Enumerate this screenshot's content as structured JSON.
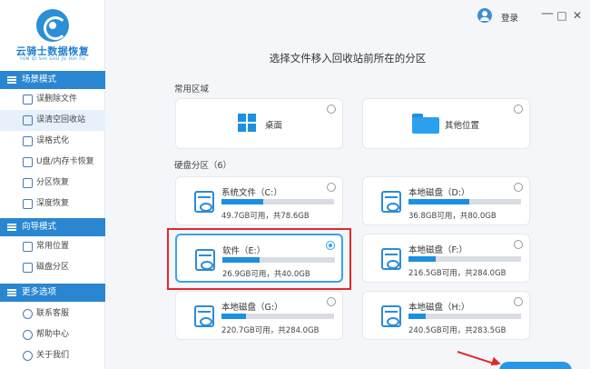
{
  "app": {
    "name": "云骑士数据恢复",
    "subtitle": "YUN QI SHI SHU JU HUI FU",
    "login_label": "登录",
    "window_controls": [
      "?",
      "—",
      "□",
      "✕"
    ]
  },
  "sidebar": {
    "sections": [
      {
        "title": "场景模式",
        "items": [
          {
            "label": "误删除文件",
            "icon": "delete-file-icon"
          },
          {
            "label": "误清空回收站",
            "icon": "recycle-bin-icon",
            "active": true
          },
          {
            "label": "误格式化",
            "icon": "format-icon"
          },
          {
            "label": "U盘/内存卡恢复",
            "icon": "usb-icon"
          },
          {
            "label": "分区恢复",
            "icon": "partition-icon"
          },
          {
            "label": "深度恢复",
            "icon": "deep-scan-icon"
          }
        ]
      },
      {
        "title": "向导模式",
        "items": [
          {
            "label": "常用位置",
            "icon": "common-location-icon"
          },
          {
            "label": "磁盘分区",
            "icon": "disk-partition-icon"
          }
        ]
      },
      {
        "title": "更多选项",
        "items": [
          {
            "label": "联系客服",
            "icon": "support-icon"
          },
          {
            "label": "帮助中心",
            "icon": "help-icon"
          },
          {
            "label": "关于我们",
            "icon": "info-icon"
          }
        ]
      }
    ]
  },
  "main": {
    "title": "选择文件移入回收站前所在的分区",
    "common_area_label": "常用区域",
    "common_areas": [
      {
        "label": "桌面",
        "icon": "windows-icon"
      },
      {
        "label": "其他位置",
        "icon": "folder-icon"
      }
    ],
    "disk_label": "硬盘分区（6）",
    "drives": [
      {
        "name": "系统文件（C:）",
        "info": "49.7GB可用，共78.6GB",
        "used_fraction": 0.37,
        "selected": false
      },
      {
        "name": "本地磁盘（D:）",
        "info": "36.8GB可用，共80.0GB",
        "used_fraction": 0.54,
        "selected": false
      },
      {
        "name": "软件（E:）",
        "info": "26.9GB可用，共40.0GB",
        "used_fraction": 0.33,
        "selected": true
      },
      {
        "name": "本地磁盘（F:）",
        "info": "216.5GB可用，共284.0GB",
        "used_fraction": 0.24,
        "selected": false
      },
      {
        "name": "本地磁盘（G:）",
        "info": "220.7GB可用，共284.0GB",
        "used_fraction": 0.22,
        "selected": false
      },
      {
        "name": "本地磁盘（H:）",
        "info": "240.5GB可用，共283.5GB",
        "used_fraction": 0.15,
        "selected": false
      }
    ]
  },
  "colors": {
    "accent": "#2a86d1",
    "highlight": "#e02a2a",
    "bar": "#1d8fe0"
  }
}
